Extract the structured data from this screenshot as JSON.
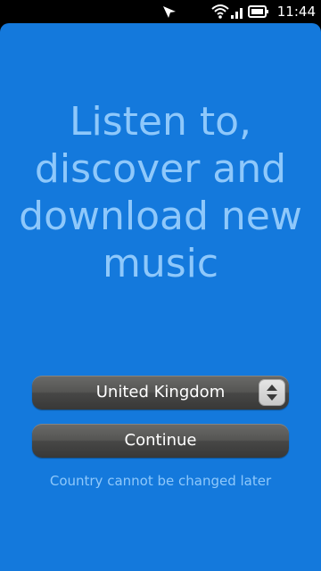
{
  "status_bar": {
    "time": "11:44",
    "icons": [
      "location-arrow-icon",
      "wifi-icon",
      "signal-bars-icon",
      "battery-icon"
    ]
  },
  "main": {
    "headline": "Listen to, discover and download new music",
    "country_select": {
      "selected": "United Kingdom",
      "icon": "up-down-arrows-icon"
    },
    "continue_label": "Continue",
    "note": "Country cannot be changed later"
  },
  "colors": {
    "background": "#1479dc",
    "headline_text": "#8ec8fb",
    "button_dark": "#474746",
    "status_bar": "#000000"
  }
}
